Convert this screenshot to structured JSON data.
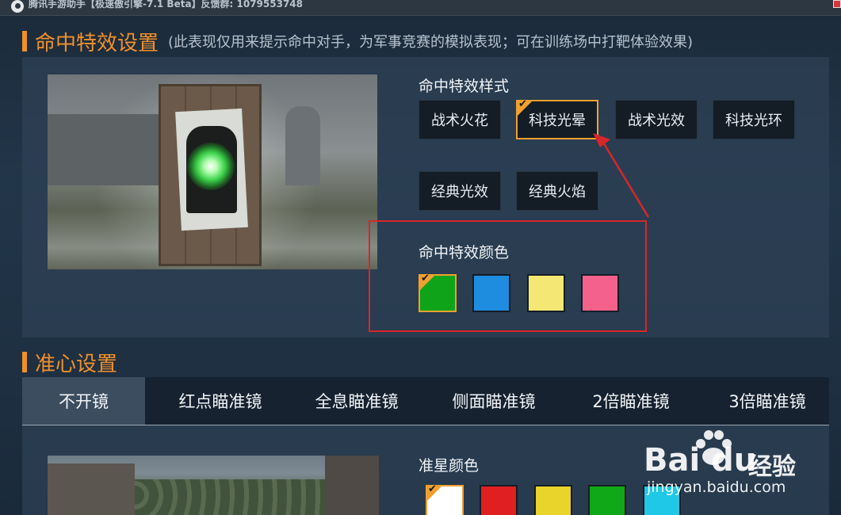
{
  "titlebar": {
    "title": "腾讯手游助手【极速傲引擎-7.1 Beta】反馈群: 1079553748"
  },
  "hit_section": {
    "title": "命中特效设置",
    "note": "(此表现仅用来提示命中对手，为军事竞赛的模拟表现；可在训练场中打靶体验效果)",
    "style_label": "命中特效样式",
    "styles": [
      {
        "label": "战术火花",
        "selected": false
      },
      {
        "label": "科技光晕",
        "selected": true
      },
      {
        "label": "战术光效",
        "selected": false
      },
      {
        "label": "科技光环",
        "selected": false
      },
      {
        "label": "经典光效",
        "selected": false
      },
      {
        "label": "经典火焰",
        "selected": false
      }
    ],
    "color_label": "命中特效颜色",
    "colors": [
      {
        "hex": "#0fa31a",
        "selected": true
      },
      {
        "hex": "#1e8de0",
        "selected": false
      },
      {
        "hex": "#f5e774",
        "selected": false
      },
      {
        "hex": "#f4628c",
        "selected": false
      }
    ]
  },
  "crosshair_section": {
    "title": "准心设置",
    "tabs": [
      {
        "label": "不开镜",
        "active": true
      },
      {
        "label": "红点瞄准镜",
        "active": false
      },
      {
        "label": "全息瞄准镜",
        "active": false
      },
      {
        "label": "侧面瞄准镜",
        "active": false
      },
      {
        "label": "2倍瞄准镜",
        "active": false
      },
      {
        "label": "3倍瞄准镜",
        "active": false
      }
    ],
    "color_label": "准星颜色",
    "colors": [
      {
        "hex": "#ffffff",
        "selected": true
      },
      {
        "hex": "#e02020",
        "selected": false
      },
      {
        "hex": "#e8d42a",
        "selected": false
      },
      {
        "hex": "#10a818",
        "selected": false
      },
      {
        "hex": "#1ec8e6",
        "selected": false
      }
    ]
  },
  "watermark": {
    "brand": "Bai du",
    "jingyan": "经验",
    "url": "jingyan.baidu.com"
  },
  "annotation_color": "#d8262b",
  "accent_color": "#f0a030"
}
